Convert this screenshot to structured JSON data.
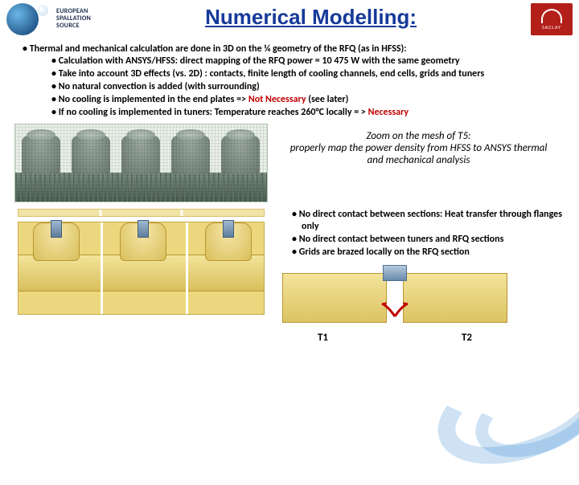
{
  "header": {
    "ess_label": "EUROPEAN\nSPALLATION\nSOURCE",
    "cea_label": "SACLAY",
    "title": "Numerical Modelling:"
  },
  "bullets": {
    "main": "Thermal and mechanical calculation are done in 3D on the ¼ geometry of the RFQ (as in HFSS):",
    "sub": [
      "Calculation with ANSYS/HFSS: direct mapping of the RFQ power = 10 475 W with the same geometry",
      "Take into account 3D effects (vs. 2D) : contacts, finite length of cooling channels, end cells, grids and tuners",
      "No natural convection is added (with surrounding)"
    ],
    "sub4_pre": "No cooling is implemented in the end plates => ",
    "sub4_red": "Not Necessary",
    "sub4_post": " (see later)",
    "sub5_pre": "If no cooling is implemented in tuners: Temperature reaches 260°C locally = > ",
    "sub5_red": "Necessary"
  },
  "caption": "Zoom on the mesh of T5:\nproperly map the power density from HFSS to ANSYS thermal and mechanical analysis",
  "lower_bullets": [
    "No direct contact between sections: Heat transfer through flanges only",
    "No direct contact between tuners and RFQ sections",
    "Grids are brazed locally on the RFQ section"
  ],
  "labels": {
    "t1": "T1",
    "t2": "T2"
  },
  "icons": {
    "ess": "ess-logo-icon",
    "cea": "cea-logo-icon"
  }
}
